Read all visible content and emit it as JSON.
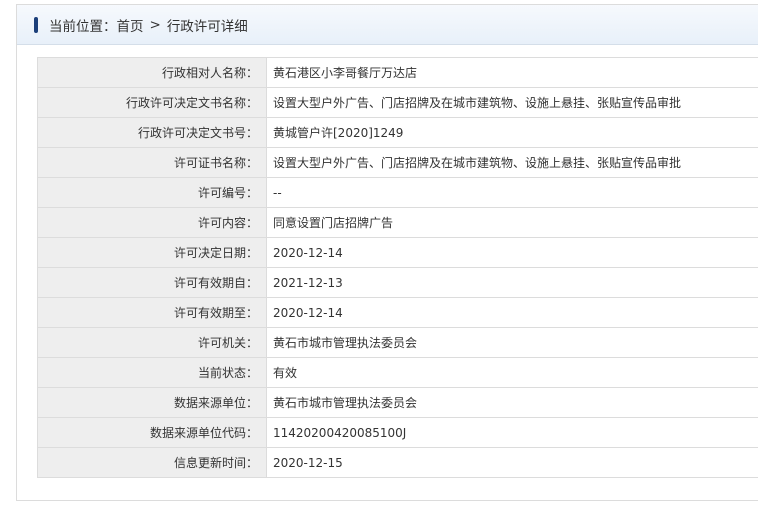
{
  "breadcrumb": {
    "prefix": "当前位置：",
    "home": "首页",
    "separator": ">",
    "current": "行政许可详细"
  },
  "details": [
    {
      "label": "行政相对人名称：",
      "value": "黄石港区小李哥餐厅万达店"
    },
    {
      "label": "行政许可决定文书名称：",
      "value": "设置大型户外广告、门店招牌及在城市建筑物、设施上悬挂、张贴宣传品审批"
    },
    {
      "label": "行政许可决定文书号：",
      "value": "黄城管户许[2020]1249"
    },
    {
      "label": "许可证书名称：",
      "value": "设置大型户外广告、门店招牌及在城市建筑物、设施上悬挂、张贴宣传品审批"
    },
    {
      "label": "许可编号：",
      "value": "--"
    },
    {
      "label": "许可内容：",
      "value": "同意设置门店招牌广告"
    },
    {
      "label": "许可决定日期：",
      "value": "2020-12-14"
    },
    {
      "label": "许可有效期自：",
      "value": "2021-12-13"
    },
    {
      "label": "许可有效期至：",
      "value": "2020-12-14"
    },
    {
      "label": "许可机关：",
      "value": "黄石市城市管理执法委员会"
    },
    {
      "label": "当前状态：",
      "value": "有效"
    },
    {
      "label": "数据来源单位：",
      "value": "黄石市城市管理执法委员会"
    },
    {
      "label": "数据来源单位代码：",
      "value": "11420200420085100J"
    },
    {
      "label": "信息更新时间：",
      "value": "2020-12-15"
    }
  ]
}
